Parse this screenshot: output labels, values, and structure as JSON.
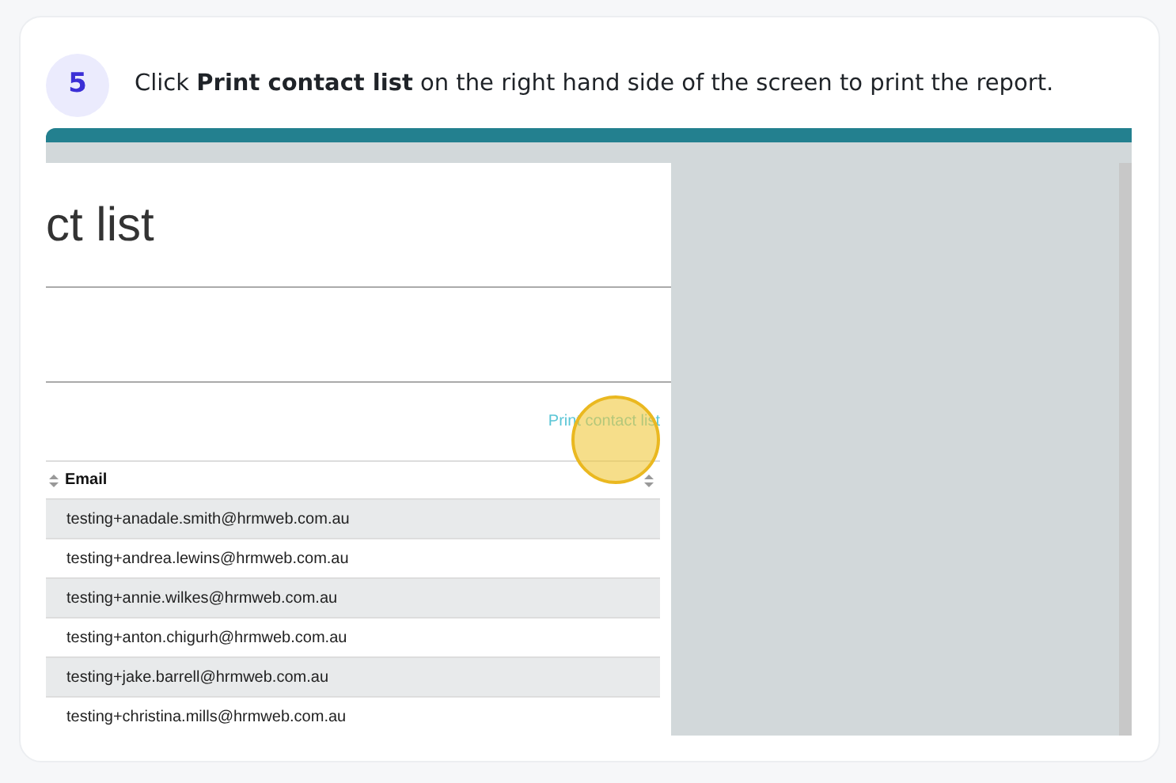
{
  "step": {
    "number": "5",
    "text": "Click **Print contact list** on the right hand side of the screen to print the report."
  },
  "screenshot": {
    "page_title": "ct list",
    "print_link": "Print contact list",
    "table": {
      "columns": [
        {
          "label": "Email"
        }
      ],
      "rows": [
        {
          "email": "testing+anadale.smith@hrmweb.com.au"
        },
        {
          "email": "testing+andrea.lewins@hrmweb.com.au"
        },
        {
          "email": "testing+annie.wilkes@hrmweb.com.au"
        },
        {
          "email": "testing+anton.chigurh@hrmweb.com.au"
        },
        {
          "email": "testing+jake.barrell@hrmweb.com.au"
        },
        {
          "email": "testing+christina.mills@hrmweb.com.au"
        }
      ]
    }
  }
}
